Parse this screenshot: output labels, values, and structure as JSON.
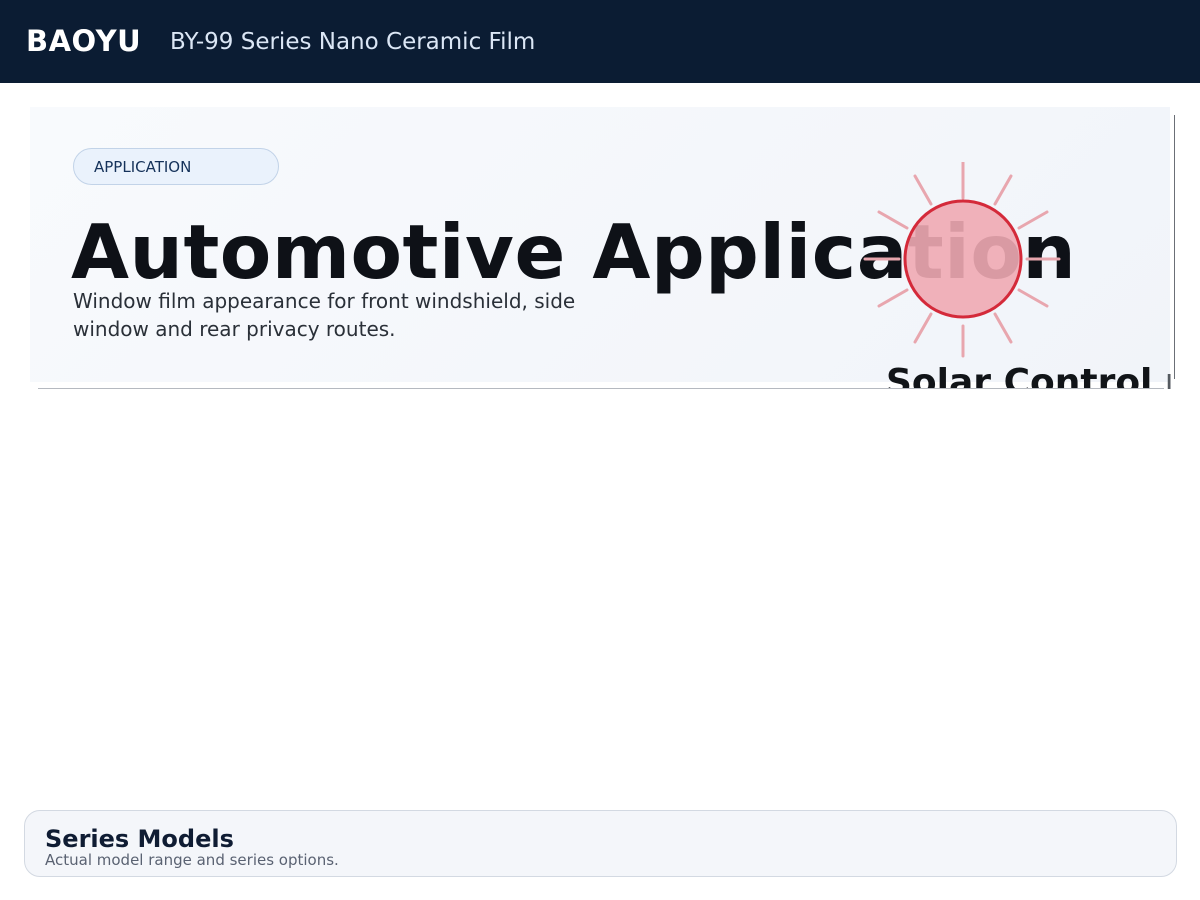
{
  "header": {
    "brand": "BAOYU",
    "product_title": "BY-99 Series Nano Ceramic Film"
  },
  "hero": {
    "badge": "APPLICATION",
    "title": "Automotive Application",
    "description": "Window film appearance for front windshield, side window and rear privacy routes.",
    "overlay_label": "Solar Control",
    "overlay_label_more": "I",
    "icon": "sun-icon",
    "colors": {
      "sun_fill": "#f0aab2",
      "sun_stroke": "#d42a3a",
      "ray": "#e8a6ae"
    }
  },
  "models": {
    "title": "Series Models",
    "subtitle": "Actual model range and series options."
  },
  "colors": {
    "header_bg": "#0b1c33",
    "brand_text": "#ffffff"
  }
}
